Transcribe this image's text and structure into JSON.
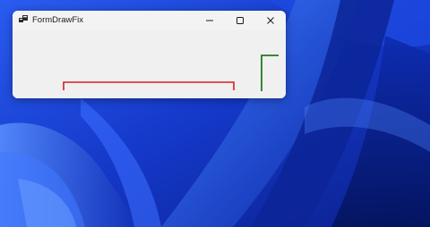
{
  "window": {
    "title": "FormDrawFix",
    "app_icon": "windows-app-icon",
    "buttons": {
      "minimize_icon": "minimize-icon",
      "maximize_icon": "maximize-icon",
      "close_icon": "close-icon"
    }
  },
  "colors": {
    "wallpaper_base": "#1a3fd4",
    "red_line": "#d81e1e",
    "green_line": "#1f7a1f",
    "window_bg": "#f0f0f0"
  }
}
